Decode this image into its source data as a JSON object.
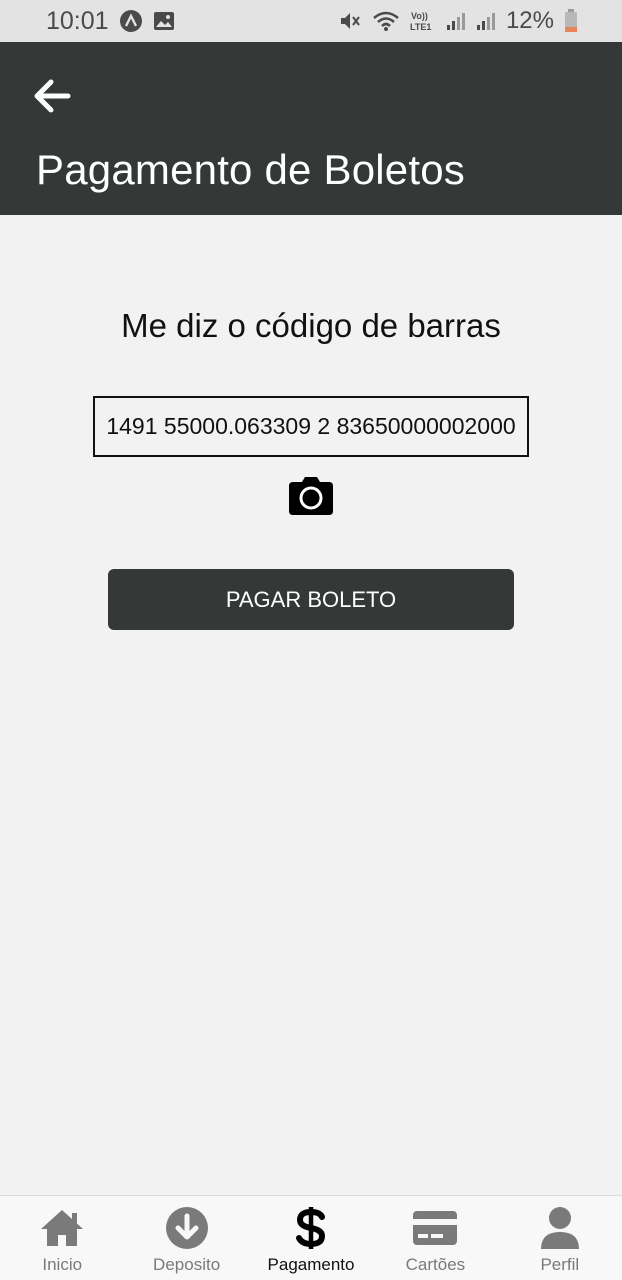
{
  "status_bar": {
    "time": "10:01",
    "battery_percent": "12%",
    "icons": [
      "a-badge-icon",
      "image-icon",
      "mute-icon",
      "wifi-icon",
      "volte-icon",
      "signal-icon",
      "signal-icon-2",
      "battery-icon"
    ]
  },
  "header": {
    "title": "Pagamento de Boletos",
    "back_icon": "arrow-left-icon"
  },
  "main": {
    "prompt": "Me diz o código de barras",
    "barcode_value": "1491 55000.063309 2 83650000002000",
    "camera_icon": "camera-icon",
    "pay_button_label": "PAGAR BOLETO"
  },
  "bottom_nav": {
    "items": [
      {
        "label": "Inicio",
        "icon": "home-icon"
      },
      {
        "label": "Deposito",
        "icon": "download-circle-icon"
      },
      {
        "label": "Pagamento",
        "icon": "dollar-icon",
        "active": true
      },
      {
        "label": "Cartões",
        "icon": "credit-card-icon"
      },
      {
        "label": "Perfil",
        "icon": "user-icon"
      }
    ]
  },
  "colors": {
    "header_bg": "#343837",
    "button_bg": "#343837",
    "page_bg": "#f2f2f2",
    "nav_inactive": "#7a7a7a",
    "nav_active": "#111111",
    "battery_low": "#e8825a"
  }
}
